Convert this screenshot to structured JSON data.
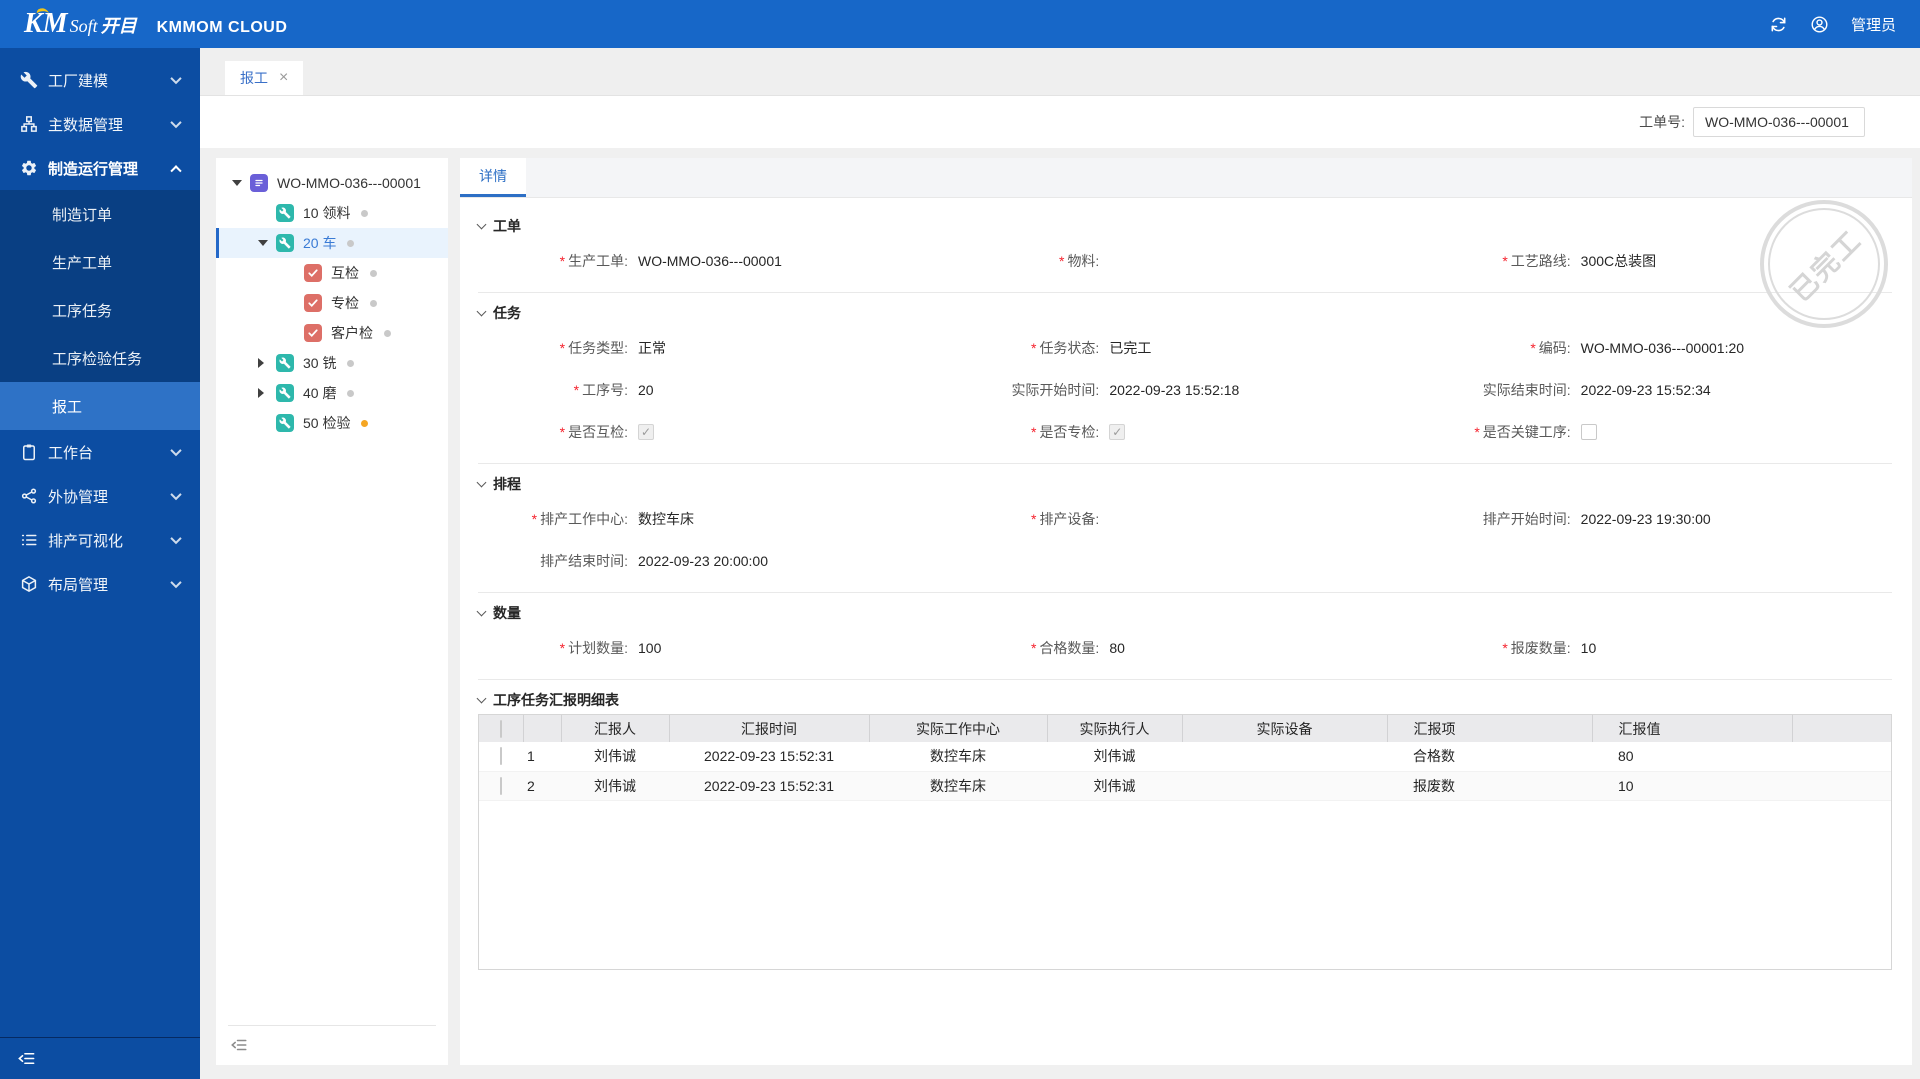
{
  "colors": {
    "header_blue": "#1767c8",
    "sidebar_blue": "#0c4da2",
    "submenu_blue": "#093f83",
    "selected_blue": "#2e72c6",
    "accent_blue": "#2d6fc5",
    "asterisk_red": "#f5222d",
    "tile_teal": "#2eb8ac",
    "tile_red": "#dd6f67",
    "tile_purple": "#6a5fd8",
    "dot_gray": "#c9c9c9",
    "dot_orange": "#f5a623",
    "stamp_gray": "#dcdcdc"
  },
  "header": {
    "logo_km": "KM",
    "logo_soft": "Soft",
    "logo_cn": "开目",
    "product": "KMMOM CLOUD",
    "user": "管理员"
  },
  "sidebar": {
    "items": [
      {
        "label": "工厂建模"
      },
      {
        "label": "主数据管理"
      },
      {
        "label": "制造运行管理"
      },
      {
        "label": "工作台"
      },
      {
        "label": "外协管理"
      },
      {
        "label": "排产可视化"
      },
      {
        "label": "布局管理"
      }
    ],
    "submenu": [
      {
        "label": "制造订单"
      },
      {
        "label": "生产工单"
      },
      {
        "label": "工序任务"
      },
      {
        "label": "工序检验任务"
      },
      {
        "label": "报工"
      }
    ]
  },
  "tabbar": {
    "tab": "报工",
    "close": "×"
  },
  "toolbar": {
    "wo_label": "工单号:",
    "wo_value": "WO-MMO-036---00001"
  },
  "tree": {
    "root": "WO-MMO-036---00001",
    "n10": "10 领料",
    "n20": "20 车",
    "n20c1": "互检",
    "n20c2": "专检",
    "n20c3": "客户检",
    "n30": "30 铣",
    "n40": "40 磨",
    "n50": "50 检验"
  },
  "detail": {
    "tab": "详情",
    "stamp": "已完工",
    "workorder": {
      "title": "工单",
      "f1": {
        "req": "*",
        "label": "生产工单:",
        "value": "WO-MMO-036---00001"
      },
      "f2": {
        "req": "*",
        "label": "物料:",
        "value": ""
      },
      "f3": {
        "req": "*",
        "label": "工艺路线:",
        "value": "300C总装图"
      }
    },
    "task": {
      "title": "任务",
      "f1": {
        "req": "*",
        "label": "任务类型:",
        "value": "正常"
      },
      "f2": {
        "req": "*",
        "label": "任务状态:",
        "value": "已完工"
      },
      "f3": {
        "req": "*",
        "label": "编码:",
        "value": "WO-MMO-036---00001:20"
      },
      "f4": {
        "req": "*",
        "label": "工序号:",
        "value": "20"
      },
      "f5": {
        "req": "",
        "label": "实际开始时间:",
        "value": "2022-09-23 15:52:18"
      },
      "f6": {
        "req": "",
        "label": "实际结束时间:",
        "value": "2022-09-23 15:52:34"
      },
      "f7": {
        "req": "*",
        "label": "是否互检:",
        "checked": true
      },
      "f8": {
        "req": "*",
        "label": "是否专检:",
        "checked": true
      },
      "f9": {
        "req": "*",
        "label": "是否关键工序:",
        "checked": false
      }
    },
    "schedule": {
      "title": "排程",
      "f1": {
        "req": "*",
        "label": "排产工作中心:",
        "value": "数控车床"
      },
      "f2": {
        "req": "*",
        "label": "排产设备:",
        "value": ""
      },
      "f3": {
        "req": "",
        "label": "排产开始时间:",
        "value": "2022-09-23 19:30:00"
      },
      "f4": {
        "req": "",
        "label": "排产结束时间:",
        "value": "2022-09-23 20:00:00"
      }
    },
    "quantity": {
      "title": "数量",
      "f1": {
        "req": "*",
        "label": "计划数量:",
        "value": "100"
      },
      "f2": {
        "req": "*",
        "label": "合格数量:",
        "value": "80"
      },
      "f3": {
        "req": "*",
        "label": "报废数量:",
        "value": "10"
      }
    },
    "report": {
      "title": "工序任务汇报明细表",
      "columns": {
        "reporter": "汇报人",
        "time": "汇报时间",
        "workcenter": "实际工作中心",
        "executor": "实际执行人",
        "equipment": "实际设备",
        "item": "汇报项",
        "value": "汇报值"
      },
      "rows": [
        {
          "no": "1",
          "reporter": "刘伟诚",
          "time": "2022-09-23 15:52:31",
          "workcenter": "数控车床",
          "executor": "刘伟诚",
          "equipment": "",
          "item": "合格数",
          "value": "80"
        },
        {
          "no": "2",
          "reporter": "刘伟诚",
          "time": "2022-09-23 15:52:31",
          "workcenter": "数控车床",
          "executor": "刘伟诚",
          "equipment": "",
          "item": "报废数",
          "value": "10"
        }
      ]
    }
  }
}
